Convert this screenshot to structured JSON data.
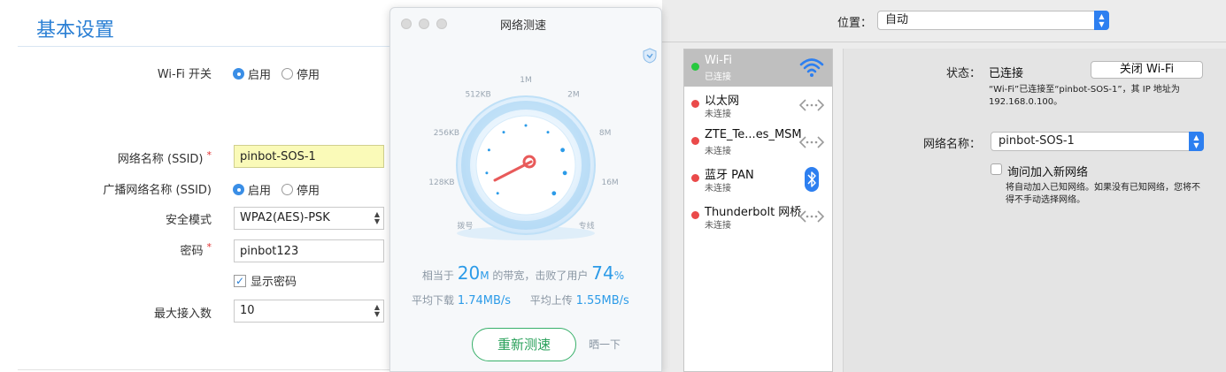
{
  "router": {
    "title": "基本设置",
    "wifi_switch": {
      "label": "Wi-Fi 开关",
      "on": "启用",
      "off": "停用"
    },
    "ssid": {
      "label": "网络名称 (SSID)",
      "required": "*",
      "value": "pinbot-SOS-1"
    },
    "broadcast": {
      "label": "广播网络名称 (SSID)",
      "on": "启用",
      "off": "停用"
    },
    "security": {
      "label": "安全模式",
      "value": "WPA2(AES)-PSK"
    },
    "password": {
      "label": "密码",
      "required": "*",
      "value": "pinbot123"
    },
    "show_password": "显示密码",
    "max_clients": {
      "label": "最大接入数",
      "value": "10"
    }
  },
  "speedtest": {
    "title": "网络测速",
    "gauge_labels": [
      "拨号",
      "128KB",
      "256KB",
      "512KB",
      "1M",
      "2M",
      "8M",
      "16M",
      "专线"
    ],
    "line1_prefix": "相当于",
    "bandwidth": "20",
    "bandwidth_unit": "M",
    "line1_mid": "的带宽，击败了用户",
    "beat": "74",
    "beat_unit": "%",
    "download_label": "平均下载",
    "download_value": "1.74MB/s",
    "upload_label": "平均上传",
    "upload_value": "1.55MB/s",
    "retest": "重新测速",
    "share": "晒一下",
    "colors": {
      "accent": "#2c9be8",
      "green": "#2aa15b",
      "needle": "#e85a5a"
    }
  },
  "network": {
    "location_label": "位置：",
    "location_value": "自动",
    "services": [
      {
        "name": "Wi-Fi",
        "status": "已连接",
        "dot": "#27c93f",
        "icon": "wifi-icon"
      },
      {
        "name": "以太网",
        "status": "未连接",
        "dot": "#ea4a4a",
        "icon": "ethernet-icon"
      },
      {
        "name": "ZTE_Te...es_MSM",
        "status": "未连接",
        "dot": "#ea4a4a",
        "icon": "ethernet-icon"
      },
      {
        "name": "蓝牙 PAN",
        "status": "未连接",
        "dot": "#ea4a4a",
        "icon": "bluetooth-icon"
      },
      {
        "name": "Thunderbolt 网桥",
        "status": "未连接",
        "dot": "#ea4a4a",
        "icon": "ethernet-icon"
      }
    ],
    "status_label": "状态：",
    "status_value": "已连接",
    "turn_off_button": "关闭 Wi-Fi",
    "status_desc_1": "“Wi-Fi”已连接至“pinbot-SOS-1”，其 IP 地址为",
    "status_desc_2": "192.168.0.100。",
    "network_name_label": "网络名称：",
    "network_name_value": "pinbot-SOS-1",
    "ask_join_label": "询问加入新网络",
    "ask_join_desc_1": "将自动加入已知网络。如果没有已知网络，您将不",
    "ask_join_desc_2": "得不手动选择网络。"
  }
}
